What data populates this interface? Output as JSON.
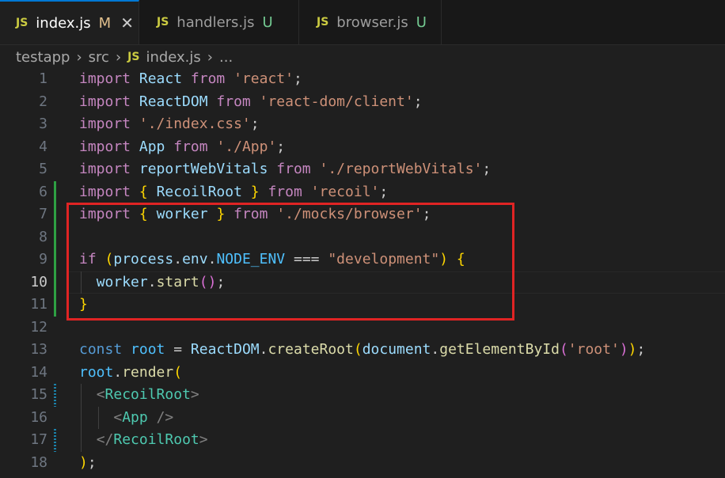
{
  "tabs": [
    {
      "icon": "JS",
      "name": "index.js",
      "badge": "M",
      "close": "✕"
    },
    {
      "icon": "JS",
      "name": "handlers.js",
      "badge": "U"
    },
    {
      "icon": "JS",
      "name": "browser.js",
      "badge": "U"
    }
  ],
  "breadcrumb": {
    "parts": [
      "testapp",
      "src"
    ],
    "separator": "›",
    "icon": "JS",
    "file": "index.js",
    "more": "..."
  },
  "line_numbers": [
    "1",
    "2",
    "3",
    "4",
    "5",
    "6",
    "7",
    "8",
    "9",
    "10",
    "11",
    "12",
    "13",
    "14",
    "15",
    "16",
    "17",
    "18"
  ],
  "code": {
    "l1": [
      "import",
      "React",
      "from",
      "'react'",
      ";"
    ],
    "l2": [
      "import",
      "ReactDOM",
      "from",
      "'react-dom/client'",
      ";"
    ],
    "l3": [
      "import",
      "'./index.css'",
      ";"
    ],
    "l4": [
      "import",
      "App",
      "from",
      "'./App'",
      ";"
    ],
    "l5": [
      "import",
      "reportWebVitals",
      "from",
      "'./reportWebVitals'",
      ";"
    ],
    "l6": [
      "import",
      "{",
      "RecoilRoot",
      "}",
      "from",
      "'recoil'",
      ";"
    ],
    "l7": [
      "import",
      "{",
      "worker",
      "}",
      "from",
      "'./mocks/browser'",
      ";"
    ],
    "l9": [
      "if",
      "(",
      "process",
      ".",
      "env",
      ".",
      "NODE_ENV",
      "===",
      "\"development\"",
      ")",
      "{"
    ],
    "l10": [
      "worker",
      ".",
      "start",
      "(",
      ")",
      ";"
    ],
    "l11": [
      "}"
    ],
    "l13": [
      "const",
      "root",
      "=",
      "ReactDOM",
      ".",
      "createRoot",
      "(",
      "document",
      ".",
      "getElementById",
      "(",
      "'root'",
      ")",
      ")",
      ";"
    ],
    "l14": [
      "root",
      ".",
      "render",
      "("
    ],
    "l15": [
      "<",
      "RecoilRoot",
      ">"
    ],
    "l16": [
      "<",
      "App",
      "/>"
    ],
    "l17": [
      "</",
      "RecoilRoot",
      ">"
    ],
    "l18": [
      ")",
      ";"
    ]
  },
  "colors": {
    "keyword": "#c586c0",
    "string": "#ce9178",
    "variable": "#9cdcfe",
    "highlight_box": "#e02424"
  }
}
